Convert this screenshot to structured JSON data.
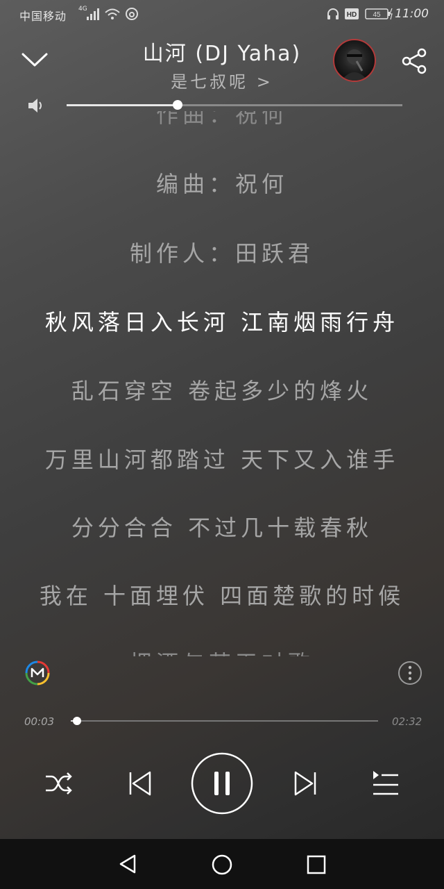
{
  "status_bar": {
    "carrier": "中国移动",
    "network": "4G",
    "battery": "45",
    "time": "11:00"
  },
  "header": {
    "title": "山河 (DJ Yaha)",
    "artist": "是七叔呢 >"
  },
  "volume": {
    "level": 0.33
  },
  "lyrics": {
    "partial_top": "作曲：祝何",
    "lines": [
      "编曲：祝何",
      "制作人：田跃君",
      "秋风落日入长河 江南烟雨行舟",
      "乱石穿空 卷起多少的烽火",
      "万里山河都踏过 天下又入谁手",
      "分分合合 不过几十载春秋",
      "我在 十面埋伏 四面楚歌的时候"
    ],
    "active_index": 2,
    "partial_bottom": "把酒与苍天对歌"
  },
  "playback": {
    "current_time": "00:03",
    "total_time": "02:32",
    "progress": 0.02
  },
  "icons": {
    "collapse": "chevron-down-icon",
    "share": "share-icon",
    "volume": "speaker-icon",
    "badge": "m-logo-icon",
    "more": "more-vertical-icon",
    "shuffle": "shuffle-icon",
    "previous": "previous-icon",
    "pause": "pause-icon",
    "next": "next-icon",
    "playlist": "playlist-icon",
    "back": "nav-back-icon",
    "home": "nav-home-icon",
    "recents": "nav-recents-icon"
  },
  "colors": {
    "accent_ring": "#b33a3a",
    "active_lyric": "#ffffff",
    "inactive_lyric": "#a6a6a6"
  }
}
